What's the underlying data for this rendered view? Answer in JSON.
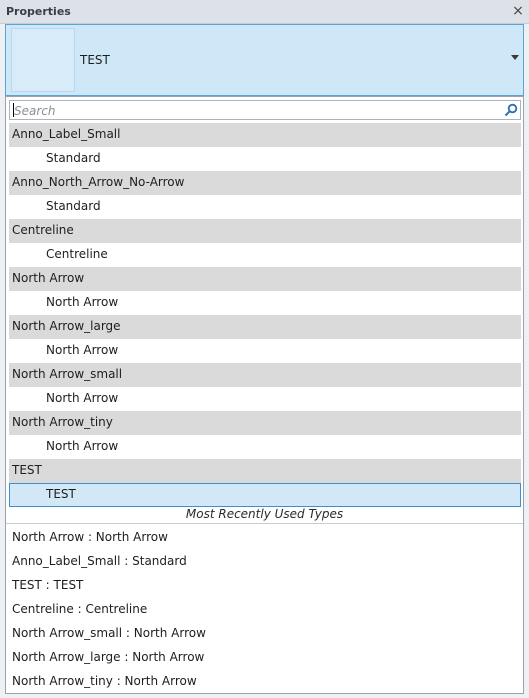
{
  "panel": {
    "title": "Properties"
  },
  "type_selector": {
    "current_type": "TEST"
  },
  "search": {
    "placeholder": "Search"
  },
  "groups": [
    {
      "family": "Anno_Label_Small",
      "types": [
        "Standard"
      ]
    },
    {
      "family": "Anno_North_Arrow_No-Arrow",
      "types": [
        "Standard"
      ]
    },
    {
      "family": "Centreline",
      "types": [
        "Centreline"
      ]
    },
    {
      "family": "North Arrow",
      "types": [
        "North Arrow"
      ]
    },
    {
      "family": "North Arrow_large",
      "types": [
        "North Arrow"
      ]
    },
    {
      "family": "North Arrow_small",
      "types": [
        "North Arrow"
      ]
    },
    {
      "family": "North Arrow_tiny",
      "types": [
        "North Arrow"
      ]
    },
    {
      "family": "TEST",
      "types": [
        "TEST"
      ],
      "selected_type": "TEST"
    }
  ],
  "mru": {
    "header": "Most Recently Used Types",
    "items": [
      "North Arrow : North Arrow",
      "Anno_Label_Small : Standard",
      "TEST : TEST",
      "Centreline : Centreline",
      "North Arrow_small : North Arrow",
      "North Arrow_large : North Arrow",
      "North Arrow_tiny : North Arrow"
    ]
  },
  "colors": {
    "selector_bg": "#cfe8f7",
    "selected_border": "#3d8fd0",
    "family_row_bg": "#dadada"
  }
}
